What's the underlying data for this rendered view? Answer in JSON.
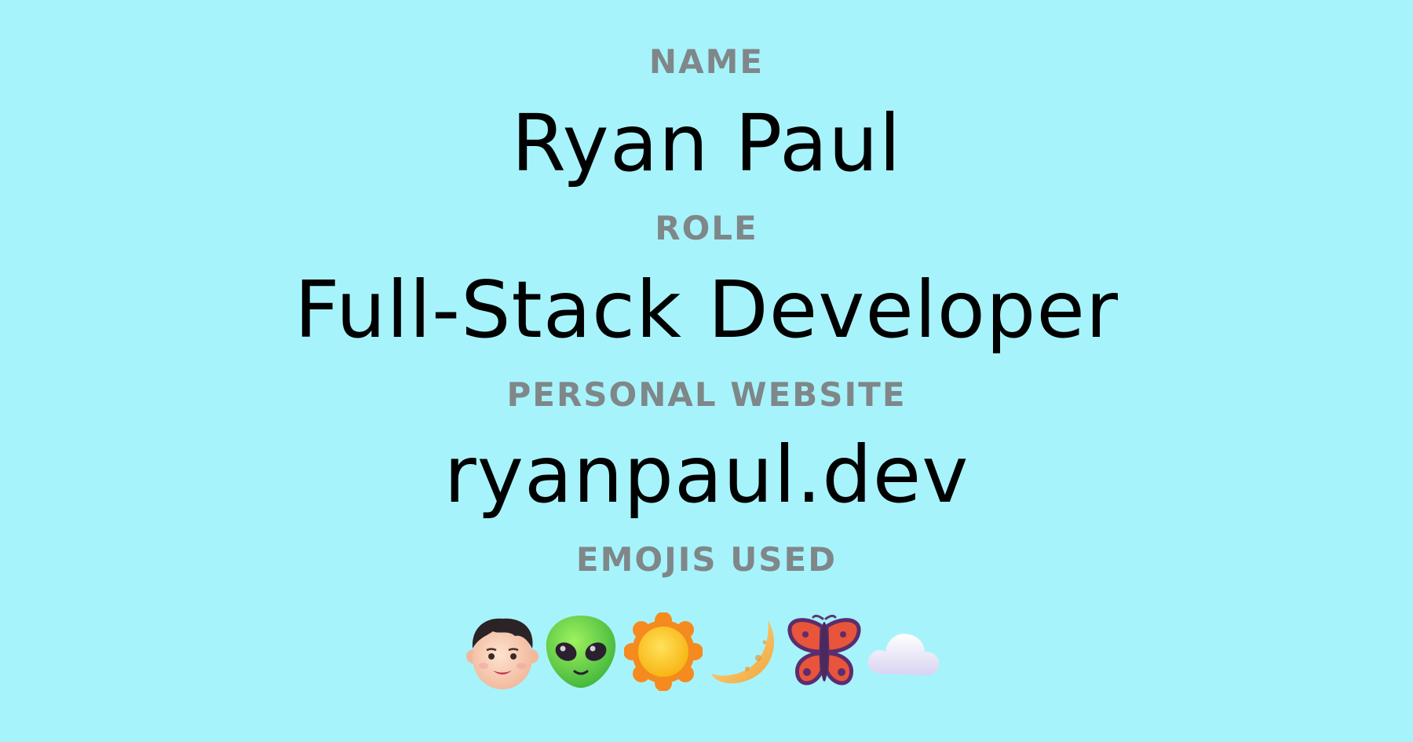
{
  "name": {
    "label": "NAME",
    "value": "Ryan Paul"
  },
  "role": {
    "label": "ROLE",
    "value": "Full-Stack Developer"
  },
  "website": {
    "label": "PERSONAL WEBSITE",
    "value": "ryanpaul.dev"
  },
  "emojis": {
    "label": "EMOJIS USED",
    "items": [
      "boy-face-icon",
      "alien-icon",
      "sun-icon",
      "crescent-moon-icon",
      "butterfly-icon",
      "cloud-icon"
    ]
  },
  "colors": {
    "background": "#a7f3fb",
    "label": "#7f8789",
    "value": "#000000"
  }
}
